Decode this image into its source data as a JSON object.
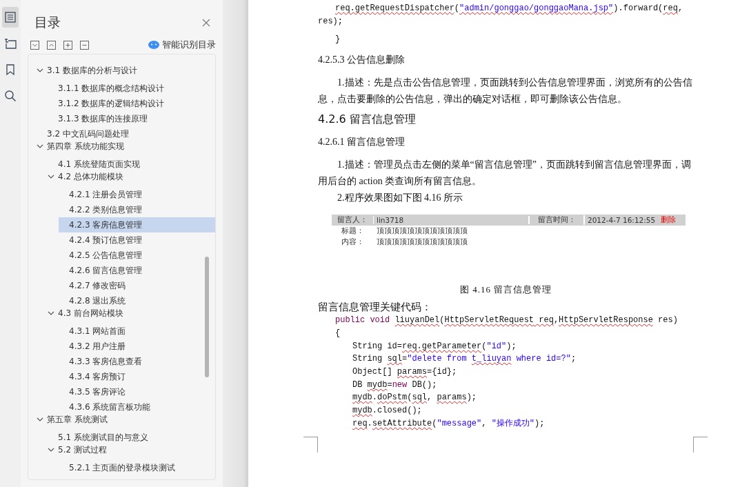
{
  "rail": [
    {
      "kind": "outline",
      "selected": true
    },
    {
      "kind": "navigation",
      "selected": false
    },
    {
      "kind": "bookmark",
      "selected": false
    },
    {
      "kind": "search",
      "selected": false
    }
  ],
  "toc": {
    "title": "目录",
    "smart_button": "智能识别目录",
    "items": [
      {
        "children": [
          {
            "label": "3.1 数据库的分析与设计",
            "expanded": true,
            "selected": false,
            "children": [
              {
                "label": "3.1.1 数据库的概念结构设计",
                "selected": false
              },
              {
                "label": "3.1.2 数据库的逻辑结构设计",
                "selected": false
              },
              {
                "label": "3.1.3 数据库的连接原理",
                "selected": false
              }
            ]
          },
          {
            "label": "3.2 中文乱码问题处理",
            "selected": false
          }
        ]
      },
      {
        "label": "第四章  系统功能实现",
        "expanded": true,
        "selected": false,
        "children": [
          {
            "label": "4.1 系统登陆页面实现",
            "selected": false
          },
          {
            "label": "4.2 总体功能模块",
            "expanded": true,
            "selected": false,
            "children": [
              {
                "label": "4.2.1 注册会员管理",
                "selected": false
              },
              {
                "label": "4.2.2 类别信息管理",
                "selected": false
              },
              {
                "label": "4.2.3 客房信息管理",
                "selected": true
              },
              {
                "label": "4.2.4 预订信息管理",
                "selected": false
              },
              {
                "label": "4.2.5 公告信息管理",
                "selected": false
              },
              {
                "label": "4.2.6 留言信息管理",
                "selected": false
              },
              {
                "label": "4.2.7 修改密码",
                "selected": false
              },
              {
                "label": "4.2.8 退出系统",
                "selected": false
              }
            ]
          },
          {
            "label": "4.3 前台网站模块",
            "expanded": true,
            "selected": false,
            "children": [
              {
                "label": "4.3.1 网站首面",
                "selected": false
              },
              {
                "label": "4.3.2 用户注册",
                "selected": false
              },
              {
                "label": "4.3.3 客房信息查看",
                "selected": false
              },
              {
                "label": "4.3.4 客房预订",
                "selected": false
              },
              {
                "label": "4.3.5 客房评论",
                "selected": false
              },
              {
                "label": "4.3.6 系统留言板功能",
                "selected": false
              }
            ]
          }
        ]
      },
      {
        "label": "第五章  系统测试",
        "expanded": true,
        "selected": false,
        "children": [
          {
            "label": "5.1 系统测试目的与意义",
            "selected": false
          },
          {
            "label": "5.2 测试过程",
            "expanded": true,
            "selected": false,
            "children": [
              {
                "label": "5.2.1 主页面的登录模块测试",
                "selected": false
              }
            ]
          }
        ]
      }
    ]
  },
  "document": {
    "blocks": [
      {
        "kind": "code",
        "lines": [
          {
            "indented": true,
            "tokens": [
              {
                "text": "req.getRequestDispatcher",
                "kind": "plain",
                "misspelled": true
              },
              {
                "text": "(",
                "kind": "plain",
                "misspelled": false
              },
              {
                "text": "\"admin/gonggao/gonggaoMana.jsp\"",
                "kind": "string",
                "misspelled": true
              },
              {
                "text": ").forward(",
                "kind": "plain",
                "misspelled": false
              },
              {
                "text": "req",
                "kind": "plain",
                "misspelled": true
              },
              {
                "text": ", res);",
                "kind": "plain",
                "misspelled": false
              }
            ]
          },
          {
            "indented": true,
            "tokens": [
              {
                "text": "}",
                "kind": "plain",
                "misspelled": false
              }
            ]
          }
        ]
      },
      {
        "kind": "subheading",
        "text": "4.2.5.3 公告信息删除"
      },
      {
        "kind": "paragraph",
        "text": "1.描述：先是点击公告信息管理，页面跳转到公告信息管理界面，浏览所有的公告信息，点击要删除的公告信息，弹出的确定对话框，即可删除该公告信息。"
      },
      {
        "kind": "heading",
        "text": "4.2.6 留言信息管理"
      },
      {
        "kind": "subheading",
        "text": "4.2.6.1 留言信息管理"
      },
      {
        "kind": "paragraph",
        "text": "1.描述：管理员点击左侧的菜单“留言信息管理”，页面跳转到留言信息管理界面，调用后台的 action 类查询所有留言信息。"
      },
      {
        "kind": "paragraph",
        "text": "2.程序效果图如下图 4.16 所示"
      },
      {
        "kind": "figure",
        "rows": [
          {
            "label": "留言人：",
            "value": "lin3718",
            "time_label": "留言时间：",
            "time": "2012-4-7 16:12:55",
            "action": "删除"
          },
          {
            "label": "标题：",
            "value": "顶顶顶顶顶顶顶顶顶顶顶顶"
          },
          {
            "label": "内容：",
            "value": "顶顶顶顶顶顶顶顶顶顶顶顶"
          }
        ]
      },
      {
        "kind": "caption",
        "text": "图 4.16  留言信息管理"
      },
      {
        "kind": "lead",
        "text": "留言信息管理关键代码："
      },
      {
        "kind": "code",
        "lines": [
          {
            "indented": true,
            "tokens": [
              {
                "text": "public void ",
                "kind": "keyword",
                "misspelled": false
              },
              {
                "text": "liuyanDel",
                "kind": "plain",
                "misspelled": true
              },
              {
                "text": "(",
                "kind": "plain",
                "misspelled": false
              },
              {
                "text": "HttpServletRequest",
                "kind": "plain",
                "misspelled": true
              },
              {
                "text": " req",
                "kind": "plain",
                "misspelled": true
              },
              {
                "text": ",",
                "kind": "plain",
                "misspelled": false
              },
              {
                "text": "HttpServletResponse",
                "kind": "plain",
                "misspelled": true
              },
              {
                "text": " res)",
                "kind": "plain",
                "misspelled": false
              }
            ]
          },
          {
            "indented": true,
            "tokens": [
              {
                "text": "{",
                "kind": "plain",
                "misspelled": false
              }
            ],
            "children": [
              {
                "indented": true,
                "tokens": [
                  {
                    "text": "String id=",
                    "kind": "plain",
                    "misspelled": false
                  },
                  {
                    "text": "req.getParameter",
                    "kind": "plain",
                    "misspelled": true
                  },
                  {
                    "text": "(",
                    "kind": "plain",
                    "misspelled": false
                  },
                  {
                    "text": "\"id\"",
                    "kind": "string",
                    "misspelled": false
                  },
                  {
                    "text": ");",
                    "kind": "plain",
                    "misspelled": false
                  }
                ]
              },
              {
                "indented": true,
                "tokens": [
                  {
                    "text": "String ",
                    "kind": "plain",
                    "misspelled": false
                  },
                  {
                    "text": "sql",
                    "kind": "plain",
                    "misspelled": true
                  },
                  {
                    "text": "=",
                    "kind": "plain",
                    "misspelled": false
                  },
                  {
                    "text": "\"delete from ",
                    "kind": "string",
                    "misspelled": false
                  },
                  {
                    "text": "t_liuyan",
                    "kind": "string",
                    "misspelled": true
                  },
                  {
                    "text": " where id=?\"",
                    "kind": "string",
                    "misspelled": false
                  },
                  {
                    "text": ";",
                    "kind": "plain",
                    "misspelled": false
                  }
                ]
              },
              {
                "indented": true,
                "tokens": [
                  {
                    "text": "Object[] ",
                    "kind": "plain",
                    "misspelled": false
                  },
                  {
                    "text": "params",
                    "kind": "plain",
                    "misspelled": true
                  },
                  {
                    "text": "={id};",
                    "kind": "plain",
                    "misspelled": false
                  }
                ]
              },
              {
                "indented": true,
                "tokens": [
                  {
                    "text": "DB ",
                    "kind": "plain",
                    "misspelled": false
                  },
                  {
                    "text": "mydb",
                    "kind": "plain",
                    "misspelled": true
                  },
                  {
                    "text": "=",
                    "kind": "plain",
                    "misspelled": false
                  },
                  {
                    "text": "new",
                    "kind": "keyword",
                    "misspelled": false
                  },
                  {
                    "text": " DB();",
                    "kind": "plain",
                    "misspelled": false
                  }
                ]
              },
              {
                "indented": true,
                "tokens": [
                  {
                    "text": "mydb",
                    "kind": "plain",
                    "misspelled": true
                  },
                  {
                    "text": ".",
                    "kind": "plain",
                    "misspelled": false
                  },
                  {
                    "text": "doPstm",
                    "kind": "plain",
                    "misspelled": true
                  },
                  {
                    "text": "(",
                    "kind": "plain",
                    "misspelled": false
                  },
                  {
                    "text": "sql",
                    "kind": "plain",
                    "misspelled": true
                  },
                  {
                    "text": ", ",
                    "kind": "plain",
                    "misspelled": false
                  },
                  {
                    "text": "params",
                    "kind": "plain",
                    "misspelled": true
                  },
                  {
                    "text": ");",
                    "kind": "plain",
                    "misspelled": false
                  }
                ]
              },
              {
                "indented": true,
                "tokens": [
                  {
                    "text": "mydb",
                    "kind": "plain",
                    "misspelled": true
                  },
                  {
                    "text": ".closed();",
                    "kind": "plain",
                    "misspelled": false
                  }
                ]
              },
              {
                "indented": true,
                "tokens": [
                  {
                    "text": "req",
                    "kind": "plain",
                    "misspelled": true
                  },
                  {
                    "text": ".",
                    "kind": "plain",
                    "misspelled": false
                  },
                  {
                    "text": "setAttribute",
                    "kind": "plain",
                    "misspelled": true
                  },
                  {
                    "text": "(",
                    "kind": "plain",
                    "misspelled": false
                  },
                  {
                    "text": "\"message\"",
                    "kind": "string",
                    "misspelled": false
                  },
                  {
                    "text": ", ",
                    "kind": "plain",
                    "misspelled": false
                  },
                  {
                    "text": "\"操作成功\"",
                    "kind": "string",
                    "misspelled": false
                  },
                  {
                    "text": ");",
                    "kind": "plain",
                    "misspelled": false
                  }
                ]
              }
            ]
          }
        ]
      }
    ]
  }
}
